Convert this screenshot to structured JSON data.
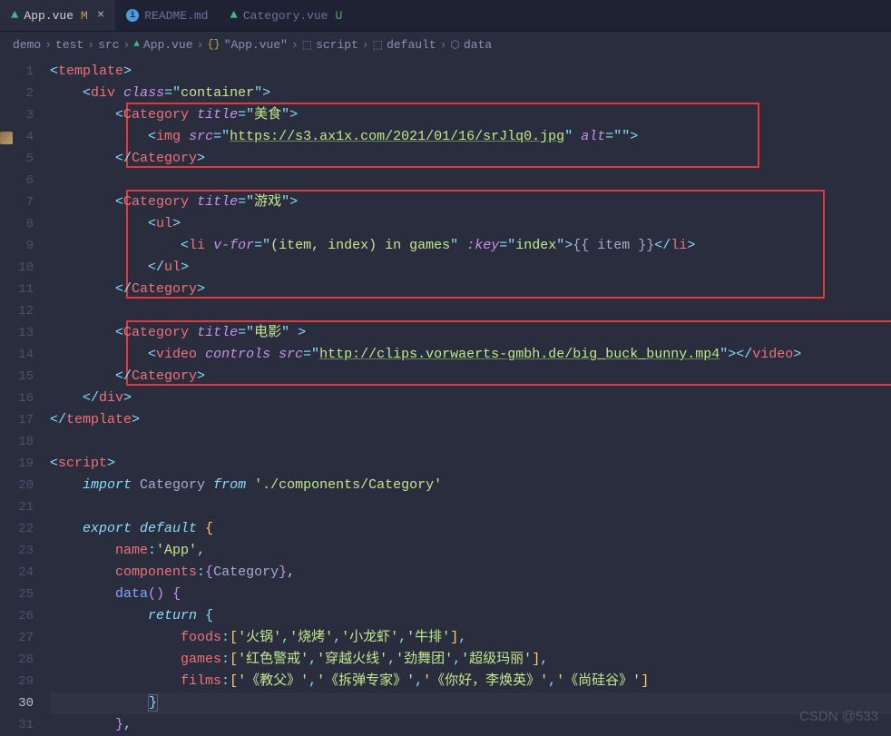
{
  "tabs": [
    {
      "icon": "vue",
      "label": "App.vue",
      "status": "M",
      "statusClass": "m",
      "active": true,
      "close": true
    },
    {
      "icon": "md",
      "label": "README.md",
      "status": "",
      "statusClass": "",
      "active": false,
      "close": false
    },
    {
      "icon": "vue",
      "label": "Category.vue",
      "status": "U",
      "statusClass": "u",
      "active": false,
      "close": false
    }
  ],
  "breadcrumb": [
    "demo",
    "test",
    "src",
    "App.vue",
    "\"App.vue\"",
    "script",
    "default",
    "data"
  ],
  "lineCount": 31,
  "currentLine": 30,
  "watermark": "CSDN @533",
  "code": {
    "l1": "<template>",
    "l2_tag": "div",
    "l2_attr": "class",
    "l2_val": "container",
    "l3_tag": "Category",
    "l3_attr": "title",
    "l3_val": "美食",
    "l4_tag": "img",
    "l4_a1": "src",
    "l4_v1": "https://s3.ax1x.com/2021/01/16/srJlq0.jpg",
    "l4_a2": "alt",
    "l4_v2": "",
    "l5_tag": "Category",
    "l7_tag": "Category",
    "l7_attr": "title",
    "l7_val": "游戏",
    "l8_tag": "ul",
    "l9_tag": "li",
    "l9_a1": "v-for",
    "l9_v1": "(item, index) in games",
    "l9_a2": ":key",
    "l9_v2": "index",
    "l9_txt": "{{ item }}",
    "l10_tag": "ul",
    "l11_tag": "Category",
    "l13_tag": "Category",
    "l13_attr": "title",
    "l13_val": "电影",
    "l14_tag": "video",
    "l14_a1": "controls",
    "l14_a2": "src",
    "l14_v2": "http://clips.vorwaerts-gmbh.de/big_buck_bunny.mp4",
    "l15_tag": "Category",
    "l16_tag": "div",
    "l17": "</template>",
    "l19": "<script>",
    "l20_kw": "import",
    "l20_name": "Category",
    "l20_from": "from",
    "l20_path": "'./components/Category'",
    "l22_kw": "export default",
    "l23_key": "name",
    "l23_val": "'App'",
    "l24_key": "components",
    "l24_val": "Category",
    "l25_key": "data",
    "l26_kw": "return",
    "l27_key": "foods",
    "l27_vals": "['火锅','烧烤','小龙虾','牛排']",
    "l28_key": "games",
    "l28_vals": "['红色警戒','穿越火线','劲舞团','超级玛丽']",
    "l29_key": "films",
    "l29_vals": "['《教父》','《拆弹专家》','《你好，李焕英》','《尚硅谷》']"
  }
}
